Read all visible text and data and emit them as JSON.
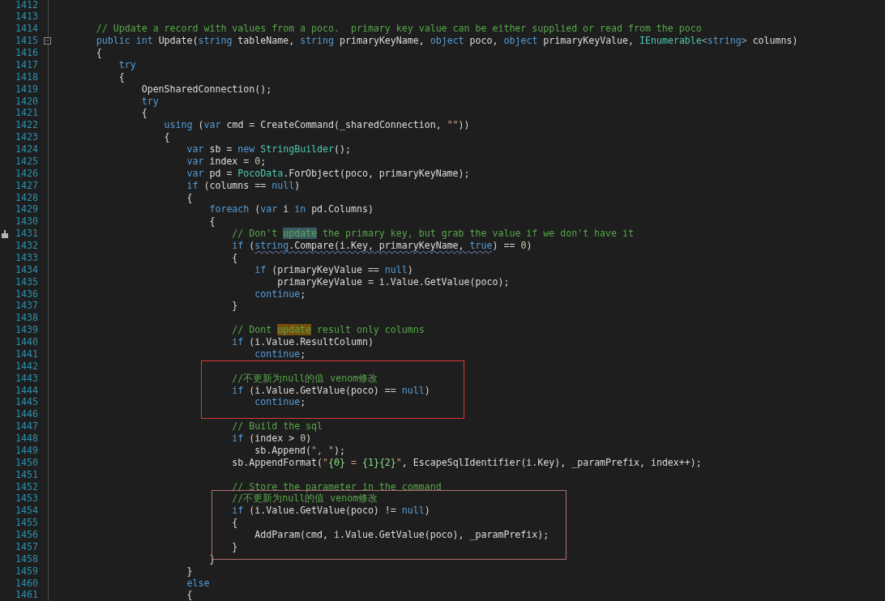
{
  "editor": {
    "lines": [
      {
        "number": "1412"
      },
      {
        "number": "1413"
      },
      {
        "number": "1414",
        "tokens": [
          {
            "kind": "comment",
            "text": "        // Update a record with values from a poco.  primary key value can be either supplied or read from the poco"
          }
        ]
      },
      {
        "number": "1415",
        "collapsible": true,
        "tokens": [
          {
            "kind": "keyword",
            "text": "        public"
          },
          {
            "kind": "keyword",
            "text": " int"
          },
          {
            "kind": "plain",
            "text": " Update("
          },
          {
            "kind": "keyword",
            "text": "string"
          },
          {
            "kind": "plain",
            "text": " tableName, "
          },
          {
            "kind": "keyword",
            "text": "string"
          },
          {
            "kind": "plain",
            "text": " primaryKeyName, "
          },
          {
            "kind": "keyword",
            "text": "object"
          },
          {
            "kind": "plain",
            "text": " poco, "
          },
          {
            "kind": "keyword",
            "text": "object"
          },
          {
            "kind": "plain",
            "text": " primaryKeyValue, "
          },
          {
            "kind": "type",
            "text": "IEnumerable"
          },
          {
            "kind": "punct",
            "text": "<"
          },
          {
            "kind": "keyword",
            "text": "string"
          },
          {
            "kind": "punct",
            "text": ">"
          },
          {
            "kind": "plain",
            "text": " columns)"
          }
        ]
      },
      {
        "number": "1416",
        "tokens": [
          {
            "kind": "plain",
            "text": "        {"
          }
        ]
      },
      {
        "number": "1417",
        "tokens": [
          {
            "kind": "keyword",
            "text": "            try"
          }
        ]
      },
      {
        "number": "1418",
        "tokens": [
          {
            "kind": "plain",
            "text": "            {"
          }
        ]
      },
      {
        "number": "1419",
        "tokens": [
          {
            "kind": "plain",
            "text": "                OpenSharedConnection();"
          }
        ]
      },
      {
        "number": "1420",
        "tokens": [
          {
            "kind": "keyword",
            "text": "                try"
          }
        ]
      },
      {
        "number": "1421",
        "tokens": [
          {
            "kind": "plain",
            "text": "                {"
          }
        ]
      },
      {
        "number": "1422",
        "tokens": [
          {
            "kind": "keyword",
            "text": "                    using"
          },
          {
            "kind": "plain",
            "text": " ("
          },
          {
            "kind": "keyword",
            "text": "var"
          },
          {
            "kind": "plain",
            "text": " cmd = CreateCommand(_sharedConnection, "
          },
          {
            "kind": "string",
            "text": "\"\""
          },
          {
            "kind": "plain",
            "text": "))"
          }
        ]
      },
      {
        "number": "1423",
        "tokens": [
          {
            "kind": "plain",
            "text": "                    {"
          }
        ]
      },
      {
        "number": "1424",
        "tokens": [
          {
            "kind": "keyword",
            "text": "                        var"
          },
          {
            "kind": "plain",
            "text": " sb = "
          },
          {
            "kind": "keyword",
            "text": "new"
          },
          {
            "kind": "type",
            "text": " StringBuilder"
          },
          {
            "kind": "plain",
            "text": "();"
          }
        ]
      },
      {
        "number": "1425",
        "tokens": [
          {
            "kind": "keyword",
            "text": "                        var"
          },
          {
            "kind": "plain",
            "text": " index = "
          },
          {
            "kind": "number",
            "text": "0"
          },
          {
            "kind": "plain",
            "text": ";"
          }
        ]
      },
      {
        "number": "1426",
        "tokens": [
          {
            "kind": "keyword",
            "text": "                        var"
          },
          {
            "kind": "plain",
            "text": " pd = "
          },
          {
            "kind": "type",
            "text": "PocoData"
          },
          {
            "kind": "plain",
            "text": ".ForObject(poco, primaryKeyName);"
          }
        ]
      },
      {
        "number": "1427",
        "tokens": [
          {
            "kind": "keyword",
            "text": "                        if"
          },
          {
            "kind": "plain",
            "text": " (columns == "
          },
          {
            "kind": "keyword",
            "text": "null"
          },
          {
            "kind": "plain",
            "text": ")"
          }
        ]
      },
      {
        "number": "1428",
        "tokens": [
          {
            "kind": "plain",
            "text": "                        {"
          }
        ]
      },
      {
        "number": "1429",
        "tokens": [
          {
            "kind": "keyword",
            "text": "                            foreach"
          },
          {
            "kind": "plain",
            "text": " ("
          },
          {
            "kind": "keyword",
            "text": "var"
          },
          {
            "kind": "plain",
            "text": " i "
          },
          {
            "kind": "keyword",
            "text": "in"
          },
          {
            "kind": "plain",
            "text": " pd.Columns)"
          }
        ]
      },
      {
        "number": "1430",
        "tokens": [
          {
            "kind": "plain",
            "text": "                            {"
          }
        ]
      },
      {
        "number": "1431",
        "quick_action": true,
        "tokens": [
          {
            "kind": "comment",
            "text": "                                // Don't "
          },
          {
            "kind": "reference",
            "text": "update"
          },
          {
            "kind": "comment",
            "text": " the primary key, but grab the value if we don't have it"
          }
        ]
      },
      {
        "number": "1432",
        "tokens": [
          {
            "kind": "keyword",
            "text": "                                if"
          },
          {
            "kind": "plain",
            "text": " ("
          },
          {
            "kind": "keyword",
            "text": "string",
            "squiggle": true
          },
          {
            "kind": "plain",
            "text": ".Compare(i.Key, primaryKeyName, ",
            "squiggle": true
          },
          {
            "kind": "keyword",
            "text": "true",
            "squiggle": true
          },
          {
            "kind": "plain",
            "text": ") == "
          },
          {
            "kind": "number",
            "text": "0"
          },
          {
            "kind": "plain",
            "text": ")"
          }
        ]
      },
      {
        "number": "1433",
        "tokens": [
          {
            "kind": "plain",
            "text": "                                {"
          }
        ]
      },
      {
        "number": "1434",
        "tokens": [
          {
            "kind": "keyword",
            "text": "                                    if"
          },
          {
            "kind": "plain",
            "text": " (primaryKeyValue == "
          },
          {
            "kind": "keyword",
            "text": "null"
          },
          {
            "kind": "plain",
            "text": ")"
          }
        ]
      },
      {
        "number": "1435",
        "tokens": [
          {
            "kind": "plain",
            "text": "                                        primaryKeyValue = i.Value.GetValue(poco);"
          }
        ]
      },
      {
        "number": "1436",
        "tokens": [
          {
            "kind": "keyword",
            "text": "                                    continue"
          },
          {
            "kind": "plain",
            "text": ";"
          }
        ]
      },
      {
        "number": "1437",
        "tokens": [
          {
            "kind": "plain",
            "text": "                                }"
          }
        ]
      },
      {
        "number": "1438"
      },
      {
        "number": "1439",
        "tokens": [
          {
            "kind": "comment",
            "text": "                                // Dont "
          },
          {
            "kind": "find",
            "text": "update"
          },
          {
            "kind": "comment",
            "text": " result only columns"
          }
        ]
      },
      {
        "number": "1440",
        "tokens": [
          {
            "kind": "keyword",
            "text": "                                if"
          },
          {
            "kind": "plain",
            "text": " (i.Value.ResultColumn)"
          }
        ]
      },
      {
        "number": "1441",
        "tokens": [
          {
            "kind": "keyword",
            "text": "                                    continue"
          },
          {
            "kind": "plain",
            "text": ";"
          }
        ]
      },
      {
        "number": "1442"
      },
      {
        "number": "1443",
        "tokens": [
          {
            "kind": "comment",
            "text": "                                //不更新为null的值 venom修改"
          }
        ]
      },
      {
        "number": "1444",
        "tokens": [
          {
            "kind": "keyword",
            "text": "                                if"
          },
          {
            "kind": "plain",
            "text": " (i.Value.GetValue(poco) == "
          },
          {
            "kind": "keyword",
            "text": "null"
          },
          {
            "kind": "plain",
            "text": ")"
          }
        ]
      },
      {
        "number": "1445",
        "tokens": [
          {
            "kind": "keyword",
            "text": "                                    continue"
          },
          {
            "kind": "plain",
            "text": ";"
          }
        ]
      },
      {
        "number": "1446"
      },
      {
        "number": "1447",
        "tokens": [
          {
            "kind": "comment",
            "text": "                                // Build the sql"
          }
        ]
      },
      {
        "number": "1448",
        "tokens": [
          {
            "kind": "keyword",
            "text": "                                if"
          },
          {
            "kind": "plain",
            "text": " (index > "
          },
          {
            "kind": "number",
            "text": "0"
          },
          {
            "kind": "plain",
            "text": ")"
          }
        ]
      },
      {
        "number": "1449",
        "tokens": [
          {
            "kind": "plain",
            "text": "                                    sb.Append("
          },
          {
            "kind": "string",
            "text": "\", \""
          },
          {
            "kind": "plain",
            "text": ");"
          }
        ]
      },
      {
        "number": "1450",
        "tokens": [
          {
            "kind": "plain",
            "text": "                                sb.AppendFormat("
          },
          {
            "kind": "string",
            "text": "\""
          },
          {
            "kind": "placeholder",
            "text": "{0}"
          },
          {
            "kind": "string",
            "text": " = "
          },
          {
            "kind": "placeholder",
            "text": "{1}{2}"
          },
          {
            "kind": "string",
            "text": "\""
          },
          {
            "kind": "plain",
            "text": ", EscapeSqlIdentifier(i.Key), _paramPrefix, index++);"
          }
        ]
      },
      {
        "number": "1451"
      },
      {
        "number": "1452",
        "tokens": [
          {
            "kind": "comment",
            "text": "                                // Store the parameter in the command"
          }
        ]
      },
      {
        "number": "1453",
        "tokens": [
          {
            "kind": "comment",
            "text": "                                //不更新为null的值 venom修改"
          }
        ]
      },
      {
        "number": "1454",
        "tokens": [
          {
            "kind": "keyword",
            "text": "                                if"
          },
          {
            "kind": "plain",
            "text": " (i.Value.GetValue(poco) != "
          },
          {
            "kind": "keyword",
            "text": "null"
          },
          {
            "kind": "plain",
            "text": ")"
          }
        ]
      },
      {
        "number": "1455",
        "tokens": [
          {
            "kind": "plain",
            "text": "                                {"
          }
        ]
      },
      {
        "number": "1456",
        "tokens": [
          {
            "kind": "plain",
            "text": "                                    AddParam(cmd, i.Value.GetValue(poco), _paramPrefix);"
          }
        ]
      },
      {
        "number": "1457",
        "tokens": [
          {
            "kind": "plain",
            "text": "                                }"
          }
        ]
      },
      {
        "number": "1458",
        "tokens": [
          {
            "kind": "plain",
            "text": "                            }"
          }
        ]
      },
      {
        "number": "1459",
        "tokens": [
          {
            "kind": "plain",
            "text": "                        }"
          }
        ]
      },
      {
        "number": "1460",
        "tokens": [
          {
            "kind": "keyword",
            "text": "                        else"
          }
        ]
      },
      {
        "number": "1461",
        "tokens": [
          {
            "kind": "plain",
            "text": "                        {"
          }
        ]
      }
    ]
  },
  "annotations": [
    {
      "color": "#d63c3c"
    },
    {
      "color": "#b07070"
    }
  ]
}
